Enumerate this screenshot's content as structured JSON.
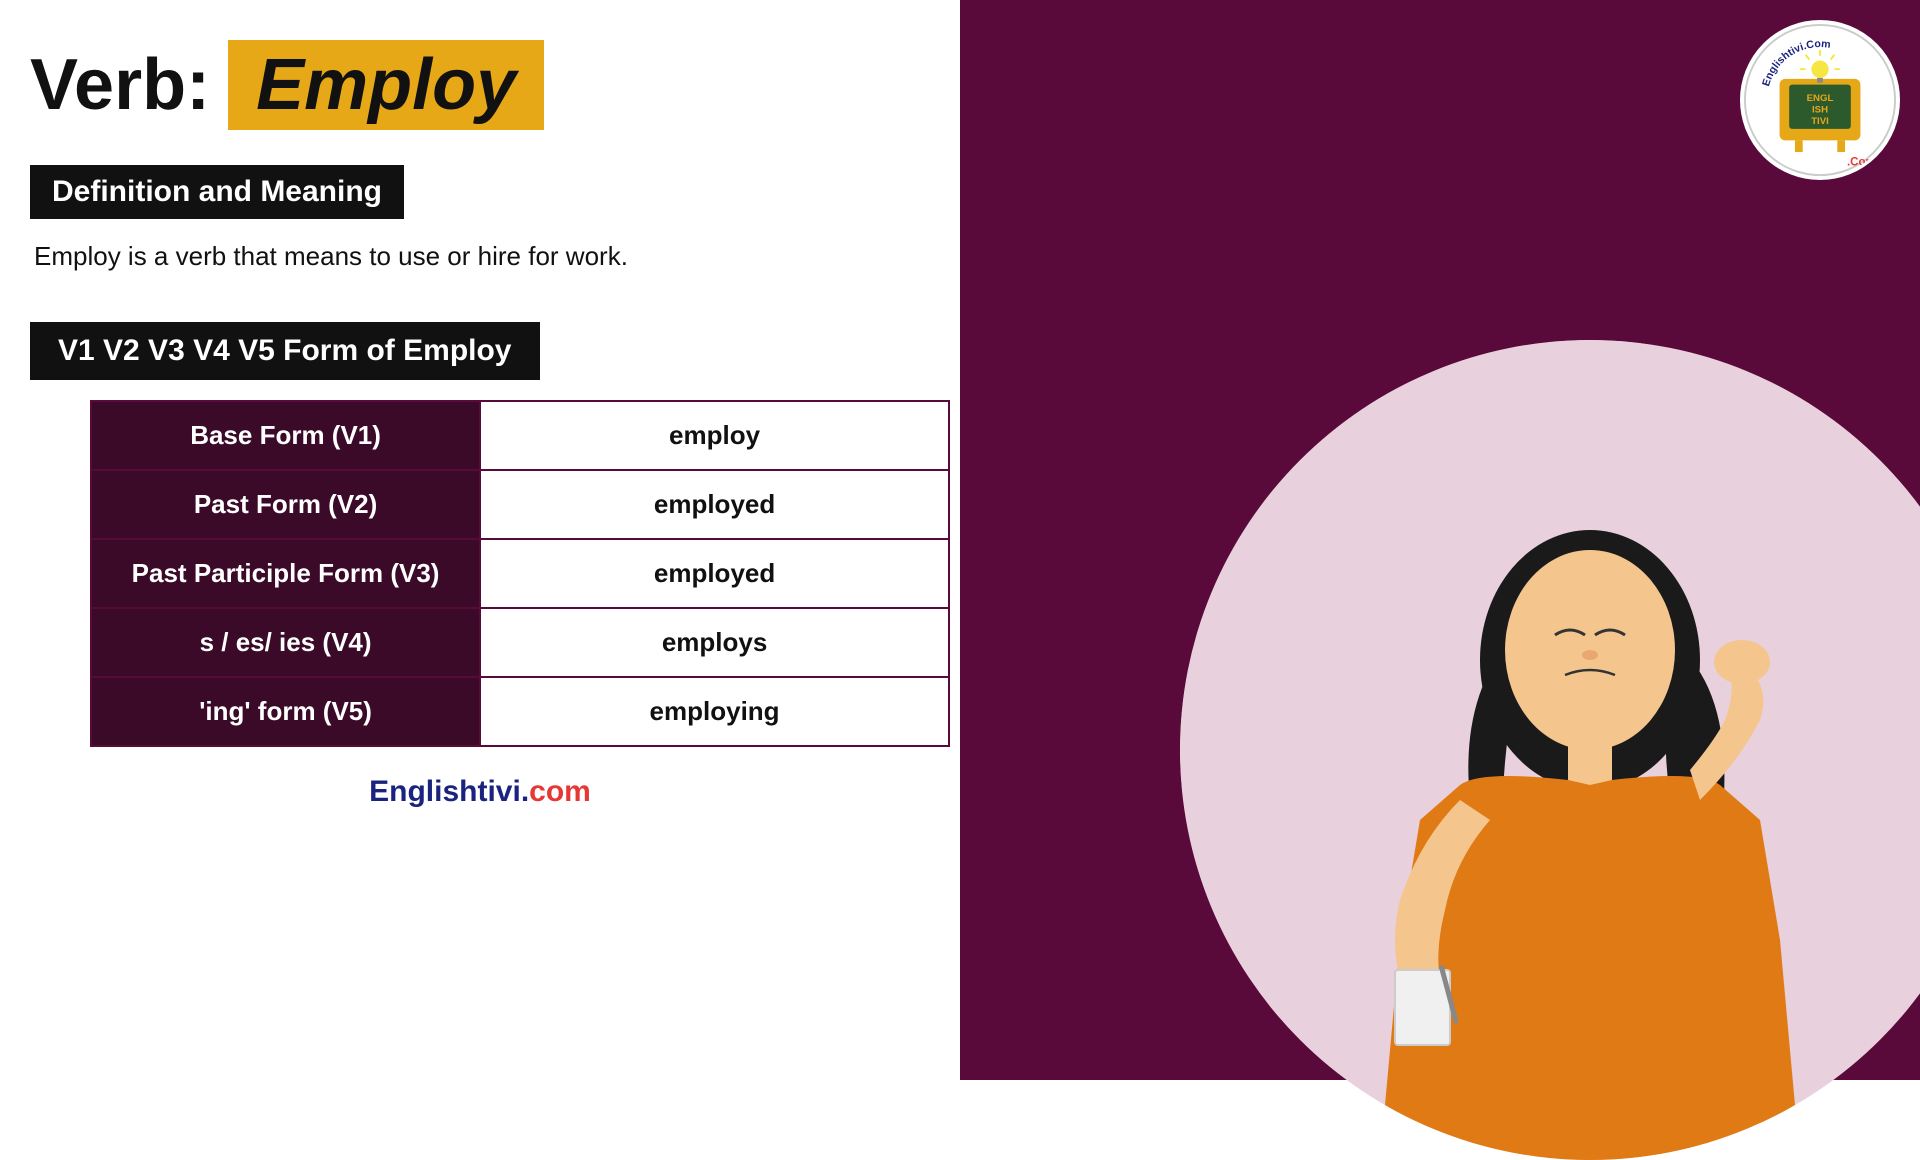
{
  "title": {
    "verb_label": "Verb:",
    "verb_word": "Employ"
  },
  "definition": {
    "heading": "Definition and Meaning",
    "text": "Employ is a verb that means to use or hire for work."
  },
  "forms_heading": "V1 V2 V3 V4 V5 Form of Employ",
  "table": {
    "rows": [
      {
        "label": "Base Form (V1)",
        "value": "employ"
      },
      {
        "label": "Past Form (V2)",
        "value": "employed"
      },
      {
        "label": "Past Participle Form (V3)",
        "value": "employed"
      },
      {
        "label": "s / es/ ies (V4)",
        "value": "employs"
      },
      {
        "label": "'ing' form (V5)",
        "value": "employing"
      }
    ]
  },
  "footer": {
    "brand_blue": "Englishtivi",
    "brand_dot": ".",
    "brand_red": "com"
  },
  "logo": {
    "text_top": "Englishtivi.Com",
    "tv_text": "ENGL\nISH\nTIVI",
    "dot_com": ".Com"
  }
}
